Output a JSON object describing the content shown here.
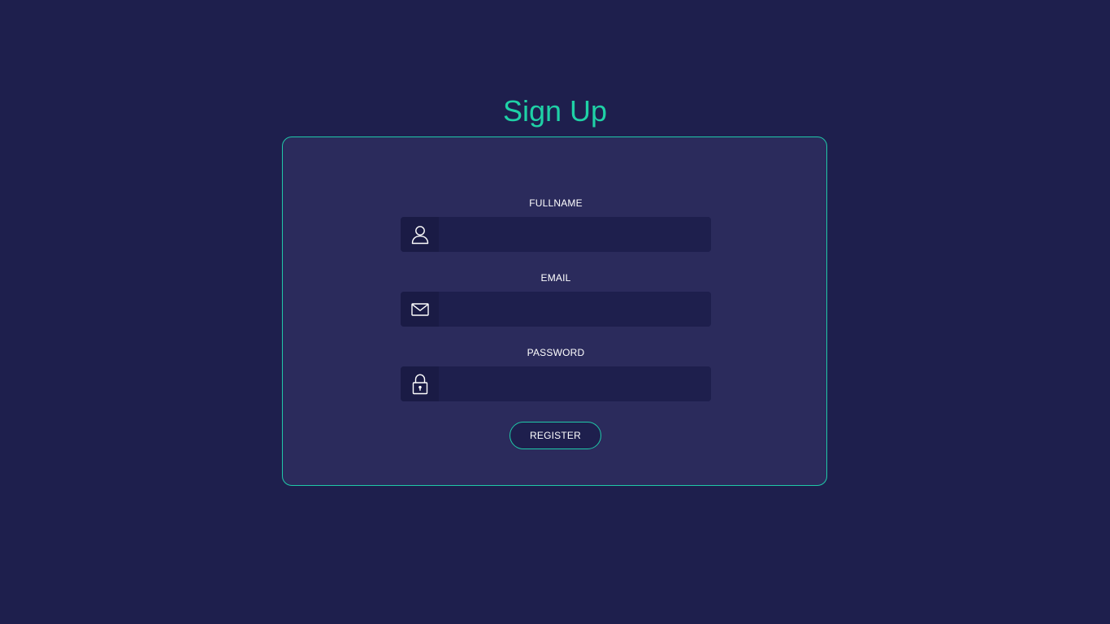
{
  "page": {
    "title": "Sign Up"
  },
  "form": {
    "fields": [
      {
        "label": "FULLNAME",
        "icon": "user-icon",
        "value": "",
        "placeholder": ""
      },
      {
        "label": "EMAIL",
        "icon": "envelope-icon",
        "value": "",
        "placeholder": ""
      },
      {
        "label": "PASSWORD",
        "icon": "lock-icon",
        "value": "",
        "placeholder": ""
      }
    ],
    "submit_label": "REGISTER"
  },
  "colors": {
    "background": "#1e1f4d",
    "card": "#2b2b5c",
    "accent": "#1fd1a6",
    "text": "#ffffff"
  }
}
